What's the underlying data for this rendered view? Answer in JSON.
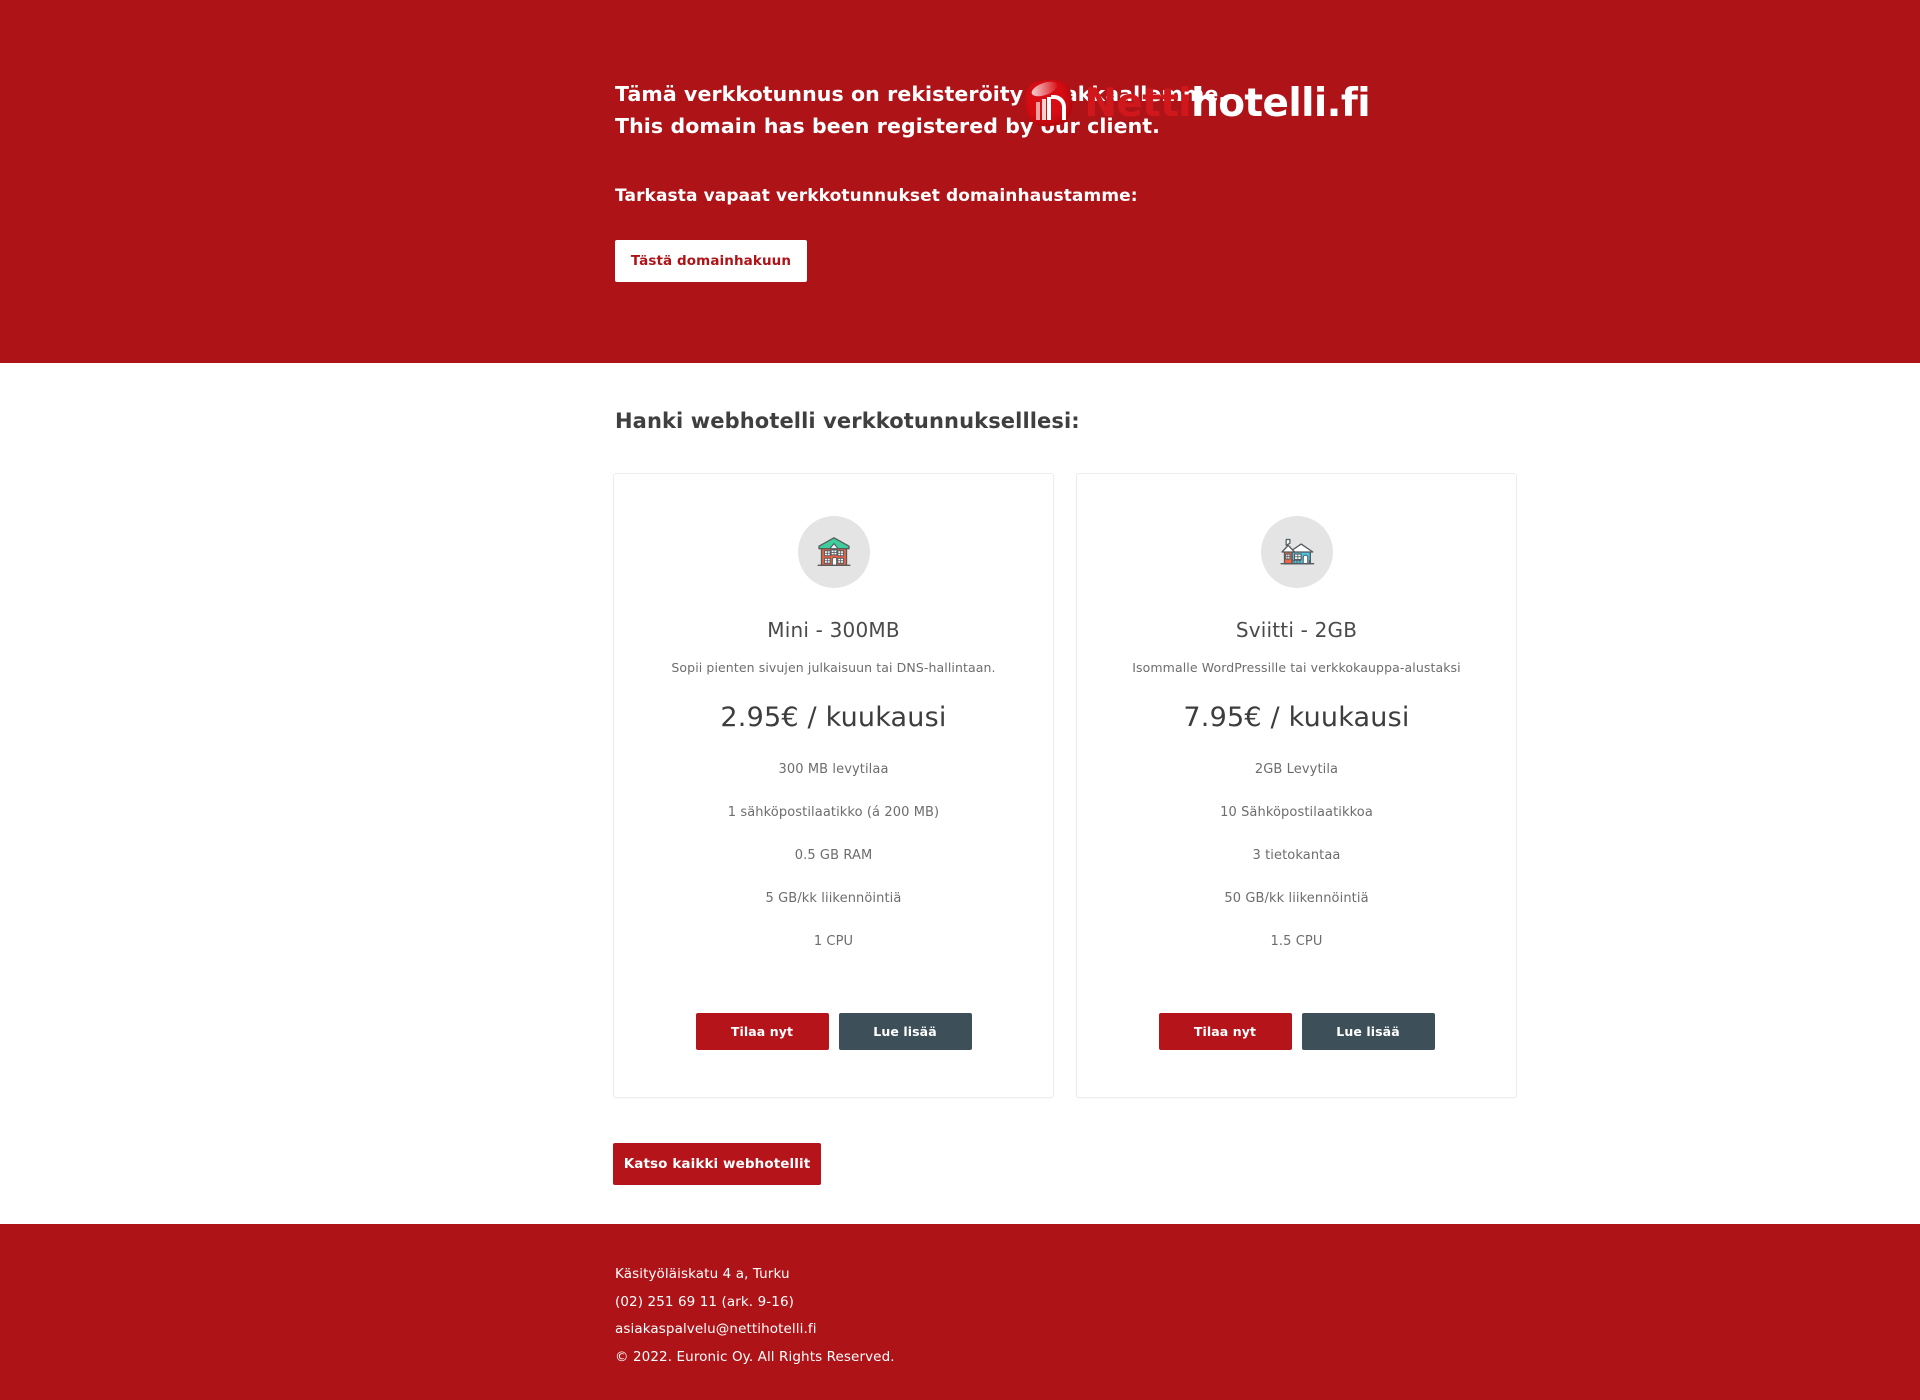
{
  "theme": {
    "brand_red": "#AE1318",
    "button_red": "#B5151A",
    "slate": "#3D5059",
    "card_border": "#ECECEC",
    "icon_circle": "#E4E4E4",
    "text_gray": "#6D6D6D"
  },
  "hero": {
    "claim_line1": "Tämä verkkotunnus on rekisteröity asiakkaallemme.",
    "claim_line2": "This domain has been registered by our client.",
    "subtitle": "Tarkasta vapaat verkkotunnukset domainhaustamme:",
    "cta_label": "Tästä domainhakuun",
    "logo": {
      "mark_name": "nettihotelli-logo-mark",
      "text_part1": "Netti",
      "text_part2": "hotelli.fi"
    }
  },
  "main": {
    "section_title": "Hanki webhotelli verkkotunnukselllesi:",
    "all_plans_label": "Katso kaikki webhotellit",
    "plans": [
      {
        "icon": "house-townhouse-icon",
        "name": "Mini - 300MB",
        "description": "Sopii pienten sivujen julkaisuun tai DNS-hallintaan.",
        "price": "2.95€ / kuukausi",
        "features": [
          "300 MB levytilaa",
          "1 sähköpostilaatikko (á 200 MB)",
          "0.5 GB RAM",
          "5 GB/kk liikennöintiä",
          "1 CPU"
        ],
        "order_label": "Tilaa nyt",
        "more_label": "Lue lisää"
      },
      {
        "icon": "house-cottage-icon",
        "name": "Sviitti - 2GB",
        "description": "Isommalle WordPressille tai verkkokauppa-alustaksi",
        "price": "7.95€ / kuukausi",
        "features": [
          "2GB Levytila",
          "10 Sähköpostilaatikkoa",
          "3 tietokantaa",
          "50 GB/kk liikennöintiä",
          "1.5 CPU"
        ],
        "order_label": "Tilaa nyt",
        "more_label": "Lue lisää"
      }
    ]
  },
  "footer": {
    "address": "Käsityöläiskatu 4 a, Turku",
    "phone": "(02) 251 69 11 (ark. 9-16)",
    "email": "asiakaspalvelu@nettihotelli.fi",
    "copyright": "© 2022. Euronic Oy. All Rights Reserved."
  }
}
